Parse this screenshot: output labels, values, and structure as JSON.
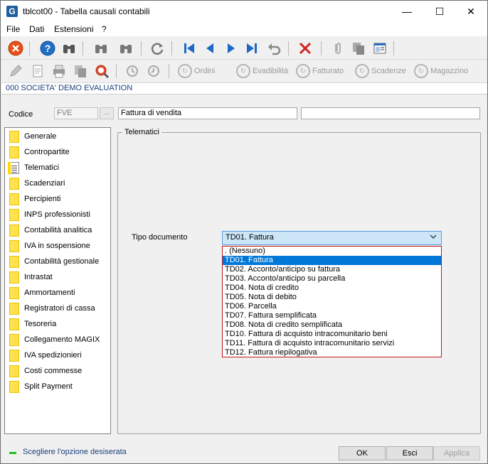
{
  "window": {
    "title": "tblcot00 - Tabella causali contabili",
    "minimize_glyph": "—",
    "maximize_glyph": "☐",
    "close_glyph": "✕"
  },
  "menu": [
    "File",
    "Dati",
    "Estensioni",
    "?"
  ],
  "toolbar1": {
    "icons": [
      "close-icon",
      "help-icon",
      "binoculars-icon",
      "binoculars-icon",
      "binoculars-icon",
      "refresh-icon",
      "first-record-icon",
      "previous-record-icon",
      "next-record-icon",
      "last-record-icon",
      "undo-icon",
      "delete-icon",
      "attachment-icon",
      "copy-icon",
      "form-icon"
    ]
  },
  "toolbar2": {
    "buttons": [
      "Ordini",
      "Evadibilità",
      "Fatturato",
      "Scadenze",
      "Magazzino"
    ]
  },
  "company": "000 SOCIETA' DEMO EVALUATION",
  "form": {
    "codice_label": "Codice",
    "codice_value": "FVE",
    "ellipsis": "...",
    "descrizione": "Fattura di vendita",
    "descrizione2": ""
  },
  "sidebar": {
    "items": [
      {
        "label": "Generale",
        "icon": "folder-icon"
      },
      {
        "label": "Contropartite",
        "icon": "folder-icon"
      },
      {
        "label": "Telematici",
        "icon": "document-icon"
      },
      {
        "label": "Scadenziari",
        "icon": "folder-icon"
      },
      {
        "label": "Percipienti",
        "icon": "folder-icon"
      },
      {
        "label": "INPS professionisti",
        "icon": "folder-icon"
      },
      {
        "label": "Contabilità analitica",
        "icon": "folder-icon"
      },
      {
        "label": "IVA in sospensione",
        "icon": "folder-icon"
      },
      {
        "label": "Contabilità gestionale",
        "icon": "folder-icon"
      },
      {
        "label": "Intrastat",
        "icon": "folder-icon"
      },
      {
        "label": "Ammortamenti",
        "icon": "folder-icon"
      },
      {
        "label": "Registratori di cassa",
        "icon": "folder-icon"
      },
      {
        "label": "Tesoreria",
        "icon": "folder-icon"
      },
      {
        "label": "Collegamento MAGIX",
        "icon": "folder-icon"
      },
      {
        "label": "IVA spedizionieri",
        "icon": "folder-icon"
      },
      {
        "label": "Costi commesse",
        "icon": "folder-icon"
      },
      {
        "label": "Split Payment",
        "icon": "folder-icon"
      }
    ]
  },
  "telematici": {
    "group_title": "Telematici",
    "tipo_label": "Tipo documento",
    "selected": "TD01. Fattura",
    "options": [
      ". (Nessuno)",
      "TD01. Fattura",
      "TD02. Acconto/anticipo su fattura",
      "TD03. Acconto/anticipo su parcella",
      "TD04. Nota di credito",
      "TD05. Nota di debito",
      "TD06. Parcella",
      "TD07. Fattura semplificata",
      "TD08. Nota di credito semplificata",
      "TD10. Fattura di acquisto intracomunitario beni",
      "TD11. Fattura di acquisto intracomunitario servizi",
      "TD12. Fattura riepilogativa"
    ]
  },
  "status": {
    "message": "Scegliere l'opzione desiserata",
    "ok": "OK",
    "esci": "Esci",
    "applica": "Applica"
  },
  "colors": {
    "accent": "#0078d7",
    "company_text": "#1a3f7c",
    "dropdown_border": "#c0151a",
    "status_led": "#21c021"
  }
}
